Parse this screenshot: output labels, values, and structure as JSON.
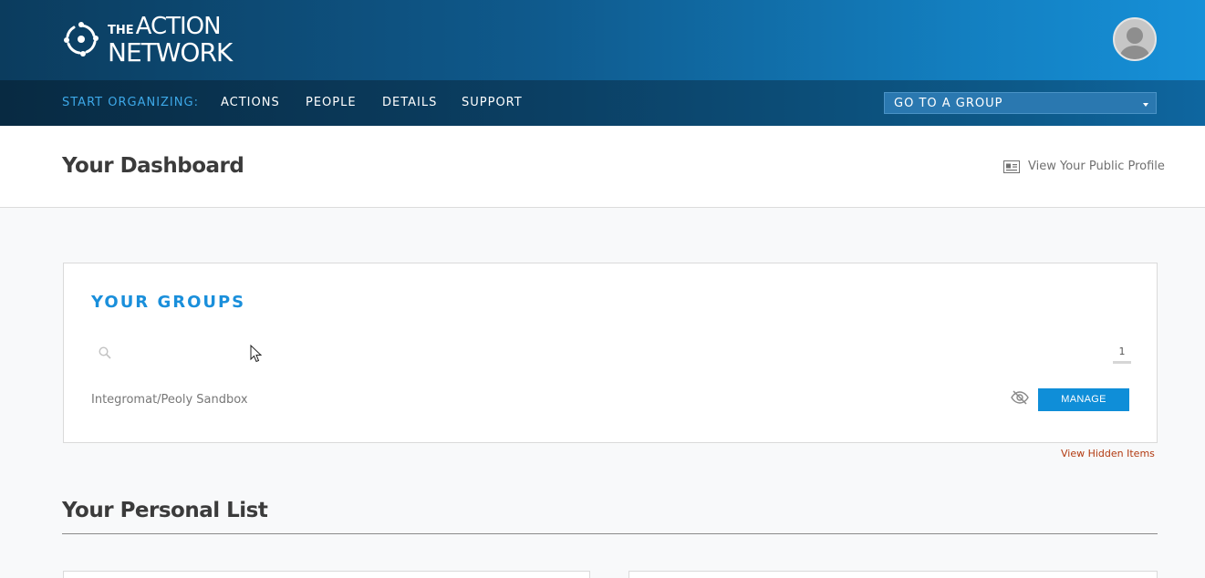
{
  "header": {
    "logo_the": "THE",
    "logo_line1": "ACTION",
    "logo_line2": "NETWORK"
  },
  "nav": {
    "label": "START ORGANIZING:",
    "items": [
      "ACTIONS",
      "PEOPLE",
      "DETAILS",
      "SUPPORT"
    ],
    "group_select": "GO TO A GROUP"
  },
  "dashboard": {
    "title": "Your Dashboard",
    "profile_link": "View Your Public Profile"
  },
  "groups": {
    "title": "YOUR GROUPS",
    "search_placeholder": "",
    "page_count": "1",
    "items": [
      {
        "name": "Integromat/Peoly Sandbox",
        "manage_label": "MANAGE"
      }
    ],
    "view_hidden": "View Hidden Items"
  },
  "personal": {
    "title": "Your Personal List"
  },
  "colors": {
    "accent": "#1a8fdb",
    "button": "#0f8ed8",
    "hidden_link": "#b23a10"
  }
}
